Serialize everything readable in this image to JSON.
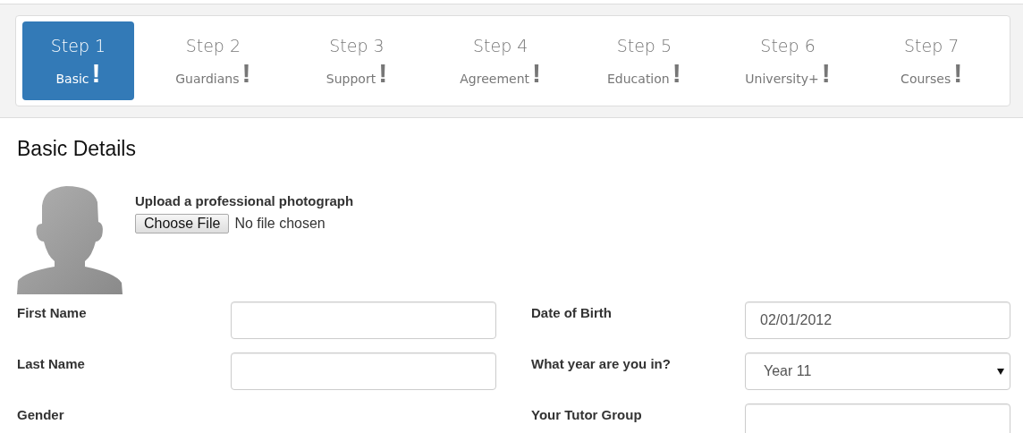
{
  "steps": [
    {
      "title": "Step 1",
      "label": "Basic",
      "mark": "!",
      "selected": true
    },
    {
      "title": "Step 2",
      "label": "Guardians",
      "mark": "!",
      "selected": false
    },
    {
      "title": "Step 3",
      "label": "Support",
      "mark": "!",
      "selected": false
    },
    {
      "title": "Step 4",
      "label": "Agreement",
      "mark": "!",
      "selected": false
    },
    {
      "title": "Step 5",
      "label": "Education",
      "mark": "!",
      "selected": false
    },
    {
      "title": "Step 6",
      "label": "University+",
      "mark": "!",
      "selected": false
    },
    {
      "title": "Step 7",
      "label": "Courses",
      "mark": "!",
      "selected": false
    }
  ],
  "heading": "Basic Details",
  "photo": {
    "label": "Upload a professional photograph",
    "button": "Choose File",
    "status": "No file chosen"
  },
  "rows": [
    {
      "left": {
        "label": "First Name",
        "kind": "input"
      },
      "right": {
        "label": "Date of Birth",
        "kind": "input",
        "value": "02/01/2012"
      }
    },
    {
      "left": {
        "label": "Last Name",
        "kind": "input"
      },
      "right": {
        "label": "What year are you in?",
        "kind": "select",
        "value": "Year 11"
      }
    },
    {
      "left": {
        "label": "Gender",
        "kind": "none"
      },
      "right": {
        "label": "Your Tutor Group",
        "kind": "input"
      }
    }
  ]
}
